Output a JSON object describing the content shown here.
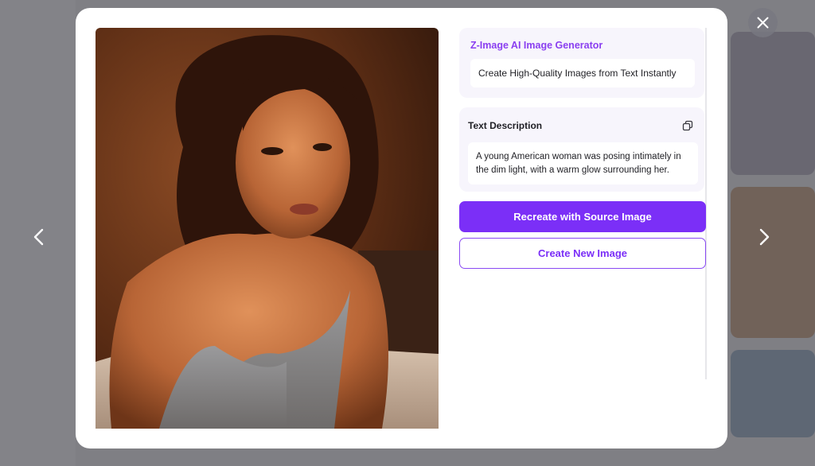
{
  "generator": {
    "title": "Z-Image AI Image Generator",
    "subtitle": "Create High-Quality Images from Text Instantly"
  },
  "description": {
    "title": "Text Description",
    "text": "A young American woman was posing intimately in the dim light, with a warm glow surrounding her.",
    "copy_icon": "copy-icon"
  },
  "actions": {
    "recreate_label": "Recreate with Source Image",
    "create_label": "Create New Image"
  },
  "navigation": {
    "close_icon": "close-icon",
    "prev_icon": "chevron-left-icon",
    "next_icon": "chevron-right-icon"
  },
  "colors": {
    "accent": "#7b2ff7",
    "accent_text": "#8a3ff0",
    "card_bg": "#f7f5fc"
  }
}
